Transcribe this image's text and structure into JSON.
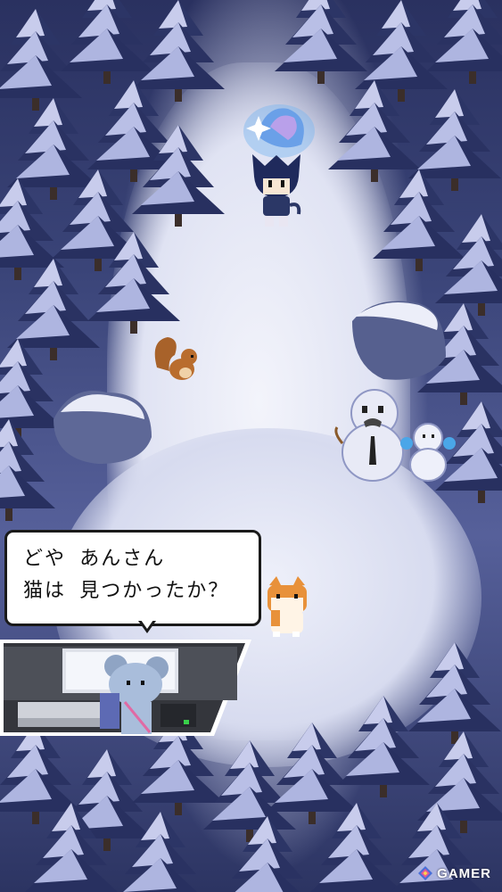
{
  "dialogue": {
    "line1": "どや あんさん",
    "line2": "猫は 見つかったか？"
  },
  "watermark": {
    "text": "GAMER",
    "icon": "gamer-logo-icon"
  },
  "colors": {
    "snow": "#eef0fa",
    "pine_shadow": "#2a3160",
    "pine_snow": "#c9cdee",
    "accent_blue": "#7ab6f0",
    "cat_orange": "#e8913a"
  }
}
